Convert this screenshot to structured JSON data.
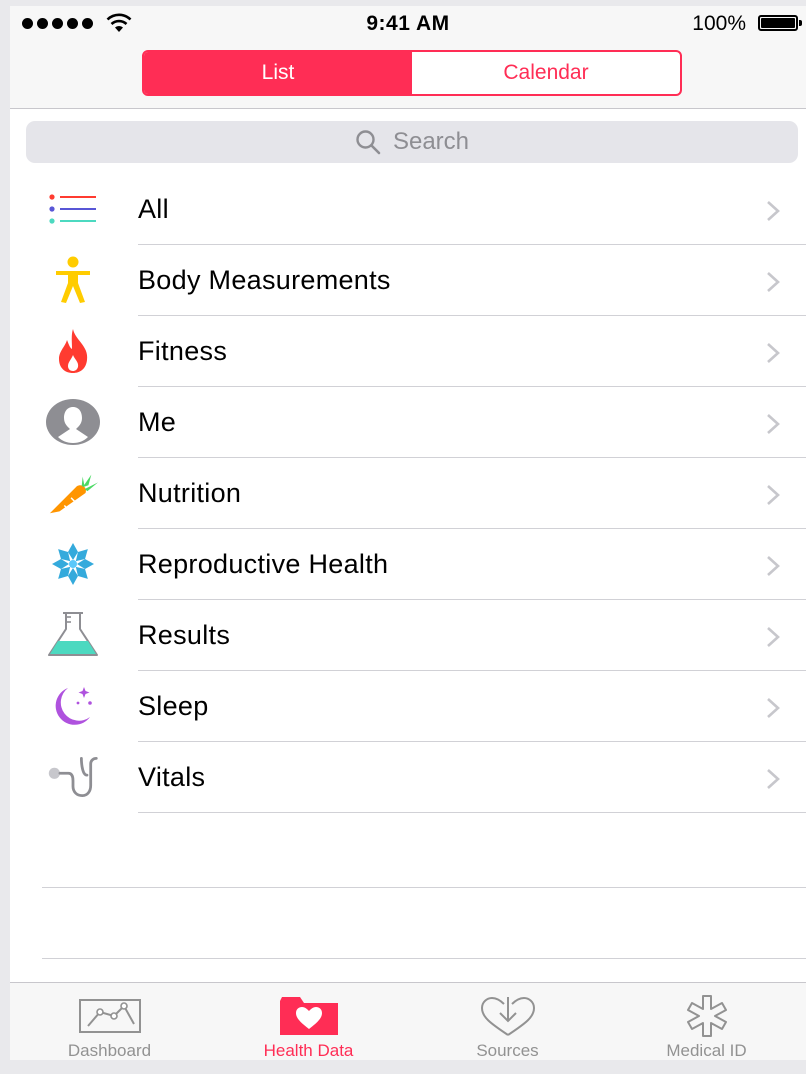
{
  "status_bar": {
    "time": "9:41 AM",
    "battery": "100%"
  },
  "segmented": {
    "list_label": "List",
    "calendar_label": "Calendar",
    "selected": "List"
  },
  "search": {
    "placeholder": "Search"
  },
  "categories": [
    {
      "label": "All",
      "icon": "list-icon"
    },
    {
      "label": "Body Measurements",
      "icon": "person-icon"
    },
    {
      "label": "Fitness",
      "icon": "flame-icon"
    },
    {
      "label": "Me",
      "icon": "profile-icon"
    },
    {
      "label": "Nutrition",
      "icon": "carrot-icon"
    },
    {
      "label": "Reproductive Health",
      "icon": "snowflake-flower-icon"
    },
    {
      "label": "Results",
      "icon": "flask-icon"
    },
    {
      "label": "Sleep",
      "icon": "moon-icon"
    },
    {
      "label": "Vitals",
      "icon": "stethoscope-icon"
    }
  ],
  "tab_bar": [
    {
      "label": "Dashboard",
      "icon": "chart-icon",
      "active": false
    },
    {
      "label": "Health Data",
      "icon": "folder-heart-icon",
      "active": true
    },
    {
      "label": "Sources",
      "icon": "download-heart-icon",
      "active": false
    },
    {
      "label": "Medical ID",
      "icon": "asterisk-icon",
      "active": false
    }
  ],
  "colors": {
    "accent": "#ff2d55",
    "separator": "#d1d1d6",
    "inactive_tab": "#929292"
  }
}
